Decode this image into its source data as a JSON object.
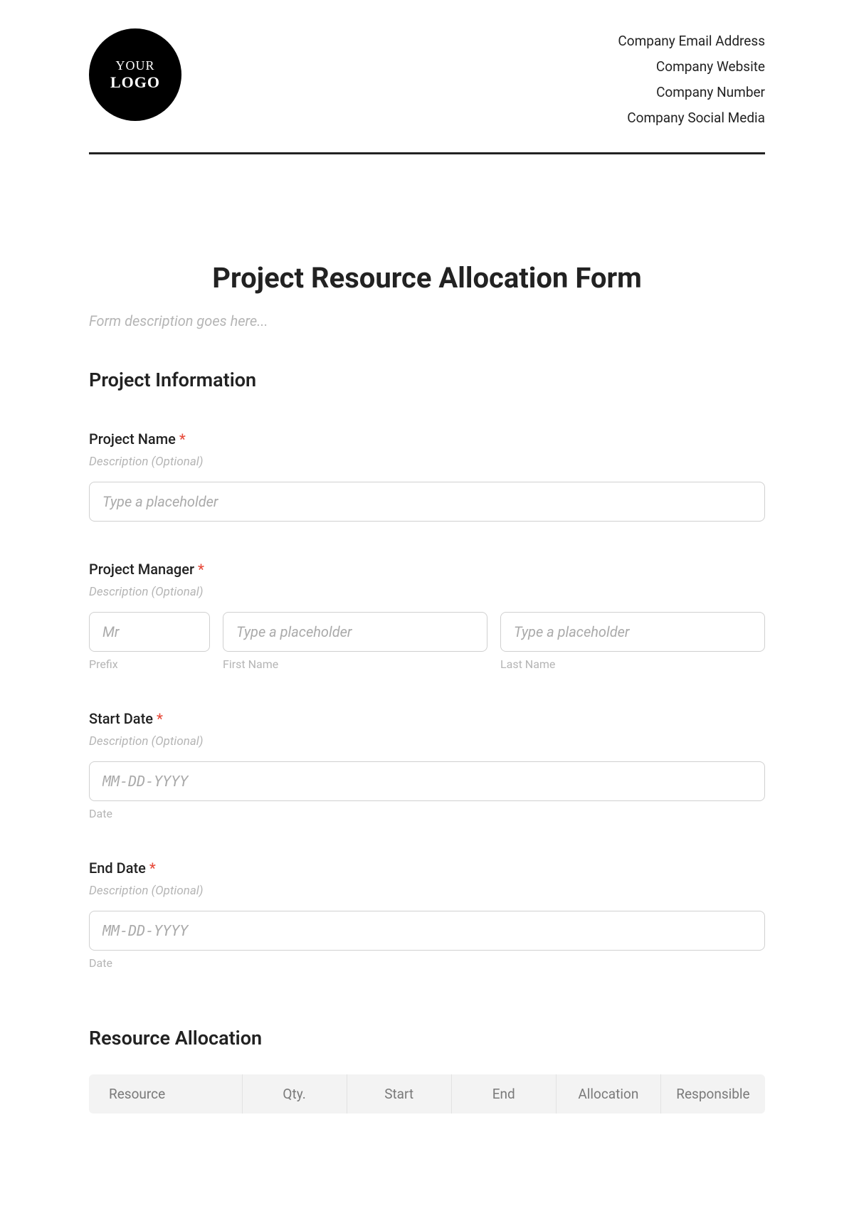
{
  "header": {
    "logo_line1": "YOUR",
    "logo_line2": "LOGO",
    "company": {
      "email": "Company Email Address",
      "website": "Company Website",
      "number": "Company Number",
      "social": "Company Social Media"
    }
  },
  "form": {
    "title": "Project Resource Allocation Form",
    "description_placeholder": "Form description goes here..."
  },
  "sections": {
    "project_info": {
      "header": "Project Information",
      "fields": {
        "project_name": {
          "label": "Project Name",
          "required": "*",
          "desc": "Description (Optional)",
          "placeholder": "Type a placeholder"
        },
        "project_manager": {
          "label": "Project Manager",
          "required": "*",
          "desc": "Description (Optional)",
          "prefix_placeholder": "Mr",
          "prefix_sublabel": "Prefix",
          "first_placeholder": "Type a placeholder",
          "first_sublabel": "First Name",
          "last_placeholder": "Type a placeholder",
          "last_sublabel": "Last Name"
        },
        "start_date": {
          "label": "Start Date",
          "required": "*",
          "desc": "Description (Optional)",
          "placeholder": "MM-DD-YYYY",
          "sublabel": "Date"
        },
        "end_date": {
          "label": "End Date",
          "required": "*",
          "desc": "Description (Optional)",
          "placeholder": "MM-DD-YYYY",
          "sublabel": "Date"
        }
      }
    },
    "resource_allocation": {
      "header": "Resource Allocation",
      "columns": {
        "resource": "Resource",
        "qty": "Qty.",
        "start": "Start",
        "end": "End",
        "allocation": "Allocation",
        "responsible": "Responsible"
      }
    }
  }
}
